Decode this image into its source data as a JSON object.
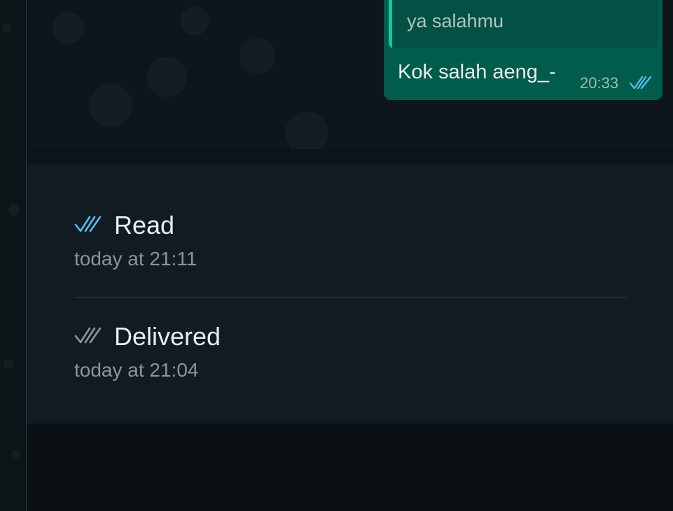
{
  "message": {
    "quoted_text": "ya salahmu",
    "text": "Kok salah aeng_-",
    "time": "20:33",
    "tick_icon": "double-check-read-icon"
  },
  "receipts": [
    {
      "label": "Read",
      "time": "today at 21:11",
      "icon": "double-check-read-icon",
      "icon_color": "#53bdeb"
    },
    {
      "label": "Delivered",
      "time": "today at 21:04",
      "icon": "double-check-delivered-icon",
      "icon_color": "#8696a0"
    }
  ],
  "colors": {
    "bubble_out": "#005c4b",
    "quote_bar": "#06cf9c",
    "read_tick": "#53bdeb",
    "panel_bg": "#111b21"
  }
}
